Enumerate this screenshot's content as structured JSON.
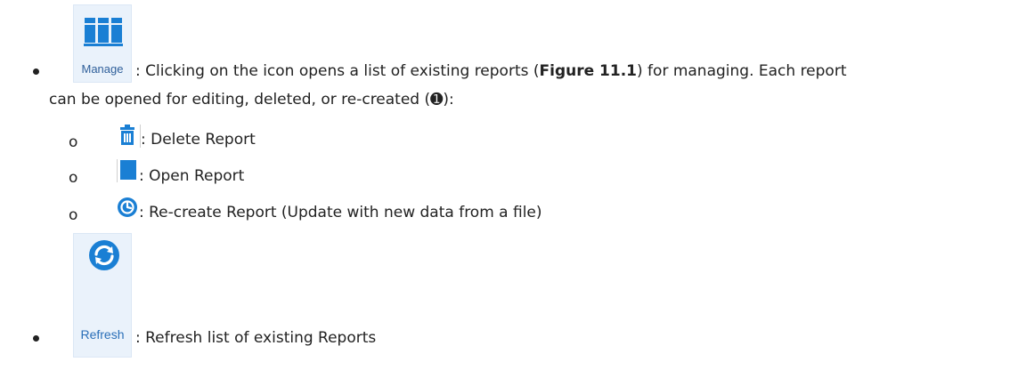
{
  "manage_item": {
    "icon": "manage-reports-icon",
    "button_label": "Manage",
    "text_line1_pre": ": Clicking on the icon opens a list of existing reports (",
    "figure_ref": "Figure 11.1",
    "text_line1_post": ") for managing. Each report",
    "text_line2": "can be opened for editing, deleted, or re-created (➊):"
  },
  "sub_items": [
    {
      "icon": "trash-icon",
      "bullet": "o",
      "text": ": Delete Report"
    },
    {
      "icon": "open-report-icon",
      "bullet": "o",
      "text": ": Open Report"
    },
    {
      "icon": "recreate-icon",
      "bullet": "o",
      "text": ": Re-create Report (Update with new data from a file)"
    }
  ],
  "refresh_item": {
    "icon": "refresh-icon",
    "button_label": "Refresh",
    "text": ": Refresh list of existing Reports"
  },
  "colors": {
    "accent": "#1a7fd4",
    "ribbon_bg": "#eaf2fb",
    "label": "#2f5f9a"
  }
}
